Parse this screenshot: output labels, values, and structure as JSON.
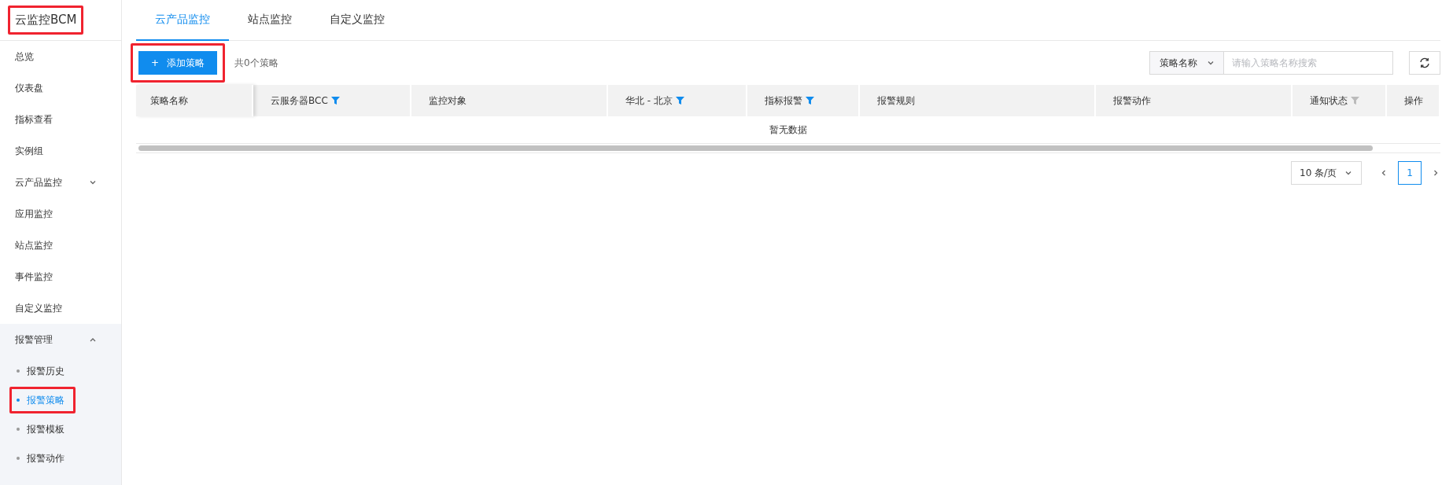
{
  "sidebar": {
    "title": "云监控BCM",
    "title_highlighted": true,
    "items": [
      {
        "label": "总览",
        "selected": false
      },
      {
        "label": "仪表盘",
        "selected": false
      },
      {
        "label": "指标查看",
        "selected": false
      },
      {
        "label": "实例组",
        "selected": false
      },
      {
        "label": "云产品监控",
        "selected": false,
        "expanded": false
      },
      {
        "label": "应用监控",
        "selected": false
      },
      {
        "label": "站点监控",
        "selected": false
      },
      {
        "label": "事件监控",
        "selected": false
      },
      {
        "label": "自定义监控",
        "selected": false
      },
      {
        "label": "报警管理",
        "selected": false,
        "expanded": true,
        "children": [
          {
            "label": "报警历史",
            "selected": false,
            "highlighted": false
          },
          {
            "label": "报警策略",
            "selected": true,
            "highlighted": true
          },
          {
            "label": "报警模板",
            "selected": false,
            "highlighted": false
          },
          {
            "label": "报警动作",
            "selected": false,
            "highlighted": false
          }
        ]
      }
    ]
  },
  "tabs": [
    {
      "label": "云产品监控",
      "selected": true
    },
    {
      "label": "站点监控",
      "selected": false
    },
    {
      "label": "自定义监控",
      "selected": false
    }
  ],
  "toolbar": {
    "add_button": "添加策略",
    "add_icon": "+",
    "add_highlighted": true,
    "count": "共0个策略",
    "search_type": "策略名称",
    "search": {
      "placeholder": "请输入策略名称搜索"
    }
  },
  "table": {
    "columns": [
      {
        "label": "策略名称",
        "filter": false
      },
      {
        "label": "云服务器BCC",
        "filter": true,
        "filter_active": true
      },
      {
        "label": "监控对象",
        "filter": false
      },
      {
        "label": "华北 - 北京",
        "filter": true,
        "filter_active": true
      },
      {
        "label": "指标报警",
        "filter": true,
        "filter_active": true
      },
      {
        "label": "报警规则",
        "filter": false
      },
      {
        "label": "报警动作",
        "filter": false
      },
      {
        "label": "通知状态",
        "filter": true,
        "filter_active": false
      },
      {
        "label": "操作",
        "filter": false
      }
    ],
    "empty_text": "暂无数据"
  },
  "pagination": {
    "page_size": "10 条/页",
    "pages": [
      {
        "label": "1",
        "selected": true
      }
    ]
  }
}
